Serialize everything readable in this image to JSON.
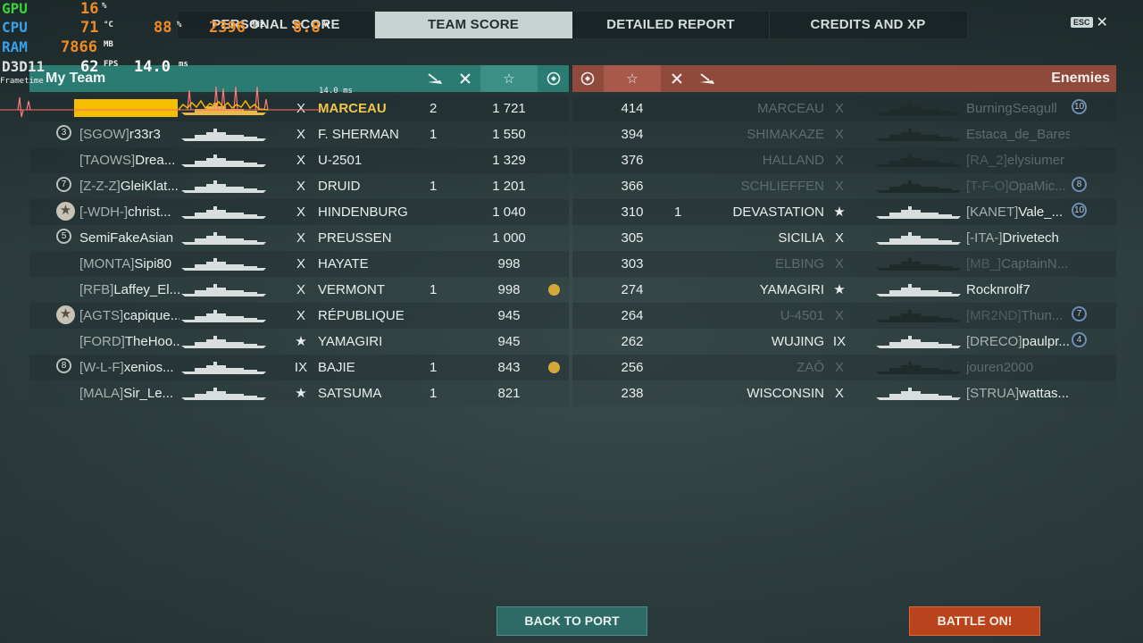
{
  "tabs": [
    {
      "label": "PERSONAL SCORE",
      "active": false
    },
    {
      "label": "TEAM SCORE",
      "active": true
    },
    {
      "label": "DETAILED REPORT",
      "active": false
    },
    {
      "label": "CREDITS AND XP",
      "active": false
    }
  ],
  "esc_label": "ESC",
  "my_team": {
    "title": "My Team",
    "header_icons": [
      "ships-destroyed-icon",
      "planes-destroyed-icon",
      "star-score-icon",
      "emblem-icon"
    ],
    "rows": [
      {
        "clan": "",
        "player": "",
        "tier": "X",
        "ship": "MARCEAU",
        "kills": "2",
        "score": "1 721",
        "rank": "",
        "self": true,
        "emblem": false
      },
      {
        "clan": "[SGOW]",
        "player": "r33r3",
        "tier": "X",
        "ship": "F. SHERMAN",
        "kills": "1",
        "score": "1 550",
        "rank": "3",
        "emblem": false
      },
      {
        "clan": "[TAOWS]",
        "player": "Drea...",
        "tier": "X",
        "ship": "U-2501",
        "kills": "",
        "score": "1 329",
        "rank": "",
        "emblem": false
      },
      {
        "clan": "[Z-Z-Z]",
        "player": "GleiKlat...",
        "tier": "X",
        "ship": "DRUID",
        "kills": "1",
        "score": "1 201",
        "rank": "7",
        "emblem": false
      },
      {
        "clan": "[-WDH-]",
        "player": "christ...",
        "tier": "X",
        "ship": "HINDENBURG",
        "kills": "",
        "score": "1 040",
        "rank": "★",
        "emblem": false
      },
      {
        "clan": "",
        "player": "SemiFakeAsian",
        "tier": "X",
        "ship": "PREUSSEN",
        "kills": "",
        "score": "1 000",
        "rank": "5",
        "emblem": false
      },
      {
        "clan": "[MONTA]",
        "player": "Sipi80",
        "tier": "X",
        "ship": "HAYATE",
        "kills": "",
        "score": "998",
        "rank": "",
        "emblem": false
      },
      {
        "clan": "[RFB]",
        "player": "Laffey_El...",
        "tier": "X",
        "ship": "VERMONT",
        "kills": "1",
        "score": "998",
        "rank": "",
        "emblem": true
      },
      {
        "clan": "[AGTS]",
        "player": "capique...",
        "tier": "X",
        "ship": "RÉPUBLIQUE",
        "kills": "",
        "score": "945",
        "rank": "★",
        "emblem": false
      },
      {
        "clan": "[FORD]",
        "player": "TheHoo...",
        "tier": "★",
        "ship": "YAMAGIRI",
        "kills": "",
        "score": "945",
        "rank": "",
        "emblem": false
      },
      {
        "clan": "[W-L-F]",
        "player": "xenios...",
        "tier": "IX",
        "ship": "BAJIE",
        "kills": "1",
        "score": "843",
        "rank": "8",
        "emblem": true
      },
      {
        "clan": "[MALA]",
        "player": "Sir_Le...",
        "tier": "★",
        "ship": "SATSUMA",
        "kills": "1",
        "score": "821",
        "rank": "",
        "emblem": false
      }
    ]
  },
  "enemies": {
    "title": "Enemies",
    "rows": [
      {
        "score": "414",
        "kills": "",
        "ship": "MARCEAU",
        "tier": "X",
        "clan": "",
        "player": "BurningSeagull",
        "rank": "10",
        "dead": true
      },
      {
        "score": "394",
        "kills": "",
        "ship": "SHIMAKAZE",
        "tier": "X",
        "clan": "",
        "player": "Estaca_de_Bares",
        "rank": "",
        "dead": true
      },
      {
        "score": "376",
        "kills": "",
        "ship": "HALLAND",
        "tier": "X",
        "clan": "[RA_2]",
        "player": "elysiumer",
        "rank": "",
        "dead": true
      },
      {
        "score": "366",
        "kills": "",
        "ship": "SCHLIEFFEN",
        "tier": "X",
        "clan": "[T-F-O]",
        "player": "OpaMic...",
        "rank": "8",
        "dead": true
      },
      {
        "score": "310",
        "kills": "1",
        "ship": "DEVASTATION",
        "tier": "★",
        "clan": "[KANET]",
        "player": "Vale_...",
        "rank": "10",
        "dead": false
      },
      {
        "score": "305",
        "kills": "",
        "ship": "SICILIA",
        "tier": "X",
        "clan": "[-ITA-]",
        "player": "Drivetech",
        "rank": "",
        "dead": false
      },
      {
        "score": "303",
        "kills": "",
        "ship": "ELBING",
        "tier": "X",
        "clan": "[MB_]",
        "player": "CaptainN...",
        "rank": "",
        "dead": true
      },
      {
        "score": "274",
        "kills": "",
        "ship": "YAMAGIRI",
        "tier": "★",
        "clan": "",
        "player": "Rocknrolf7",
        "rank": "",
        "dead": false
      },
      {
        "score": "264",
        "kills": "",
        "ship": "U-4501",
        "tier": "X",
        "clan": "[MR2ND]",
        "player": "Thun...",
        "rank": "7",
        "dead": true
      },
      {
        "score": "262",
        "kills": "",
        "ship": "WUJING",
        "tier": "IX",
        "clan": "[DRECO]",
        "player": "paulpr...",
        "rank": "4",
        "dead": false
      },
      {
        "score": "256",
        "kills": "",
        "ship": "ZAŌ",
        "tier": "X",
        "clan": "",
        "player": "jouren2000",
        "rank": "",
        "dead": true
      },
      {
        "score": "238",
        "kills": "",
        "ship": "WISCONSIN",
        "tier": "X",
        "clan": "[STRUA]",
        "player": "wattas...",
        "rank": "",
        "dead": false
      }
    ]
  },
  "buttons": {
    "back": "BACK TO PORT",
    "battle": "BATTLE ON!"
  },
  "overlay": {
    "gpu": {
      "label": "GPU",
      "value": "16",
      "unit": "%",
      "color": "#3bd13b"
    },
    "cpu": {
      "label": "CPU",
      "value": "71",
      "unit": "°C",
      "extra1": "88",
      "extra1_unit": "%",
      "extra2": "2396",
      "extra2_unit": "MHz",
      "extra3": "8.8",
      "extra3_unit": "W",
      "color": "#3aa0e8"
    },
    "ram": {
      "label": "RAM",
      "value": "7866",
      "unit": "MB",
      "color": "#3aa0e8"
    },
    "d3d": {
      "label": "D3D11",
      "value": "62",
      "unit": "FPS",
      "extra": "14.0",
      "extra_unit": "ms",
      "color": "#e0e0e0"
    },
    "frametime_label": "Frametime",
    "frametime_value": "14.0 ms",
    "value_color": "#f08a24"
  }
}
